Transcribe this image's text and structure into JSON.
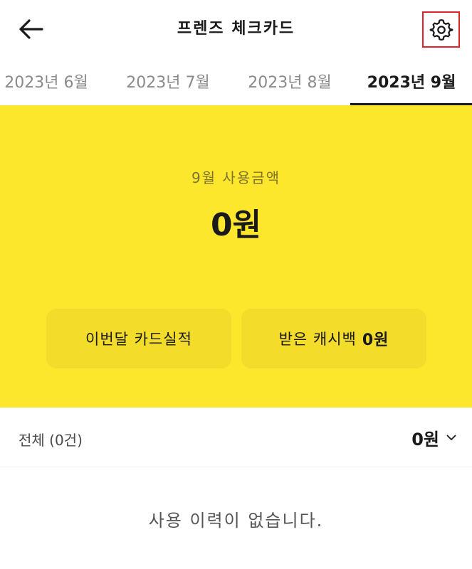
{
  "header": {
    "title": "프렌즈 체크카드",
    "back_icon": "arrow-left-icon",
    "settings_icon": "gear-icon"
  },
  "tabs": [
    {
      "label": "2023년 6월",
      "active": false
    },
    {
      "label": "2023년 7월",
      "active": false
    },
    {
      "label": "2023년 8월",
      "active": false
    },
    {
      "label": "2023년 9월",
      "active": true
    }
  ],
  "summary": {
    "label": "9월 사용금액",
    "amount": "0원",
    "background_color": "#fde72d",
    "card_performance_label": "이번달 카드실적",
    "cashback_label": "받은 캐시백",
    "cashback_amount": "0원"
  },
  "list": {
    "count_label": "전체 (0건)",
    "total_amount": "0원",
    "empty_message": "사용 이력이 없습니다."
  },
  "colors": {
    "accent_yellow": "#fde72d",
    "pill_yellow": "#f3dc2a",
    "highlight_border": "#e0232b"
  }
}
